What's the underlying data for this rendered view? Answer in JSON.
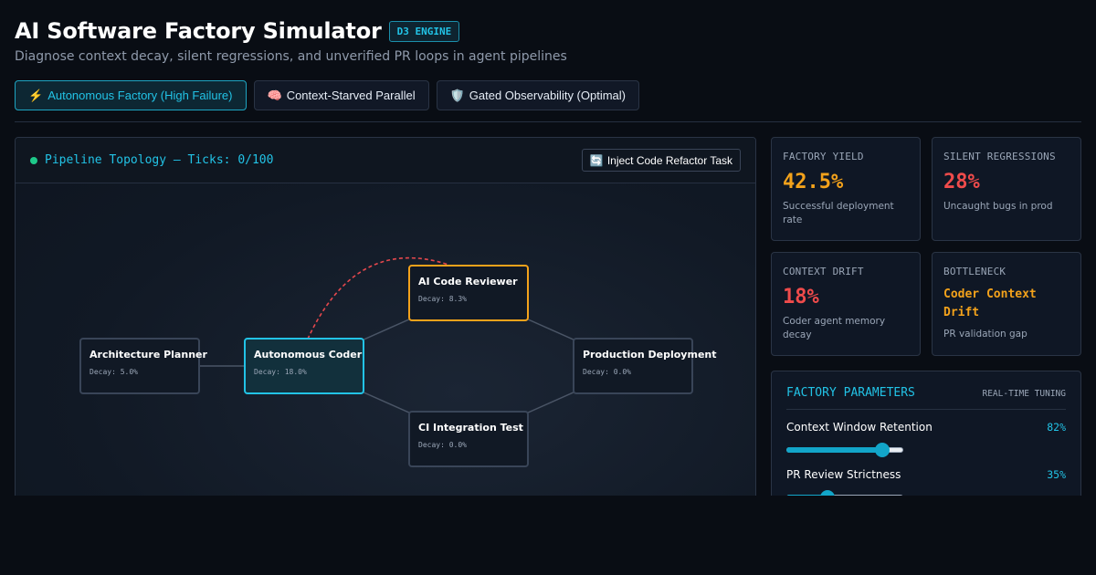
{
  "header": {
    "title": "AI Software Factory Simulator",
    "badge": "D3 ENGINE",
    "subtitle": "Diagnose context decay, silent regressions, and unverified PR loops in agent pipelines"
  },
  "scenarios": [
    {
      "icon": "⚡",
      "label": "Autonomous Factory (High Failure)",
      "active": true
    },
    {
      "icon": "🧠",
      "label": "Context-Starved Parallel",
      "active": false
    },
    {
      "icon": "🛡️",
      "label": "Gated Observability (Optimal)",
      "active": false
    }
  ],
  "topology": {
    "title": "Pipeline Topology — Ticks: 0/100",
    "inject_icon": "🔄",
    "inject_label": "Inject Code Refactor Task",
    "nodes": [
      {
        "label": "Architecture Planner",
        "decay": "Decay: 5.0%",
        "state": "normal"
      },
      {
        "label": "Autonomous Coder",
        "decay": "Decay: 18.0%",
        "state": "active"
      },
      {
        "label": "AI Code Reviewer",
        "decay": "Decay: 8.3%",
        "state": "warn"
      },
      {
        "label": "CI Integration Test",
        "decay": "Decay: 0.0%",
        "state": "normal"
      },
      {
        "label": "Production Deployment",
        "decay": "Decay: 0.0%",
        "state": "normal"
      }
    ],
    "colors": {
      "edge": "#4a5566",
      "feedback": "#e5484d",
      "active": "#22c3e6",
      "warn": "#f3a21b"
    }
  },
  "metrics": {
    "yield": {
      "label": "Factory Yield",
      "value": "42.5%",
      "desc": "Successful deployment rate"
    },
    "regressions": {
      "label": "Silent Regressions",
      "value": "28%",
      "desc": "Uncaught bugs in prod"
    },
    "drift": {
      "label": "Context Drift",
      "value": "18%",
      "desc": "Coder agent memory decay"
    },
    "bottleneck": {
      "label": "Bottleneck",
      "value": "Coder Context Drift",
      "desc": "PR validation gap"
    }
  },
  "parameters": {
    "title": "Factory Parameters",
    "subtitle": "Real-time tuning",
    "items": [
      {
        "label": "Context Window Retention",
        "value": "82%",
        "level": 0.82
      },
      {
        "label": "PR Review Strictness",
        "value": "35%",
        "level": 0.35
      }
    ]
  }
}
